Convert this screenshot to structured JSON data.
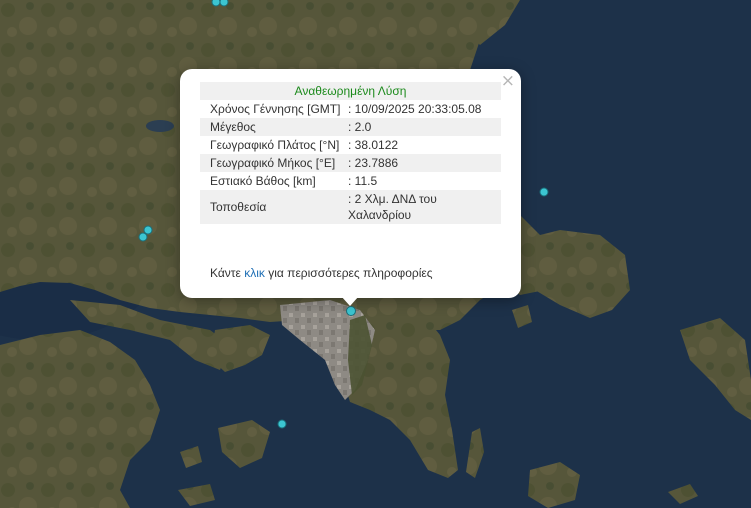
{
  "map": {
    "colors": {
      "sea": "#1c3049",
      "sea_light": "#23405e",
      "land": "#59583a",
      "land_dark": "#3f4a2e",
      "urban": "#9a958e",
      "marker": "#3cc5d1"
    }
  },
  "popup": {
    "title": "Αναθεωρημένη Λύση",
    "close_symbol": "×",
    "rows": [
      {
        "label": "Χρόνος Γέννησης [GMT]",
        "value": ": 10/09/2025 20:33:05.08"
      },
      {
        "label": "Μέγεθος",
        "value": ": 2.0"
      },
      {
        "label": "Γεωγραφικό Πλάτος [°N]",
        "value": ": 38.0122"
      },
      {
        "label": "Γεωγραφικό Μήκος [°E]",
        "value": ": 23.7886"
      },
      {
        "label": "Εστιακό Βάθος [km]",
        "value": ": 11.5"
      },
      {
        "label": "Τοποθεσία",
        "value": ": 2 Χλμ. ΔΝΔ του Χαλανδρίου"
      }
    ],
    "more_prefix": "Κάντε ",
    "more_link": "κλικ",
    "more_suffix": " για περισσότερες πληροφορίες"
  }
}
